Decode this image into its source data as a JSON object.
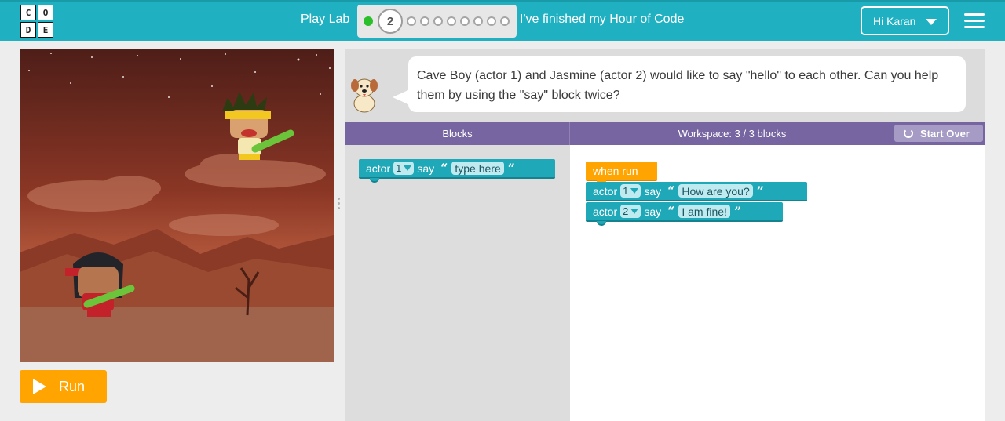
{
  "header": {
    "logo_letters": [
      "C",
      "O",
      "D",
      "E"
    ],
    "title": "Play Lab",
    "current_level": "2",
    "total_dots": 8,
    "finished_link": "I've finished my Hour of Code",
    "user_button": "Hi Karan",
    "menu_icon": "hamburger-icon",
    "accent_color": "#1fb0c2"
  },
  "game": {
    "run_label": "Run",
    "run_color": "#ffa400"
  },
  "instructions": {
    "text": "Cave Boy (actor 1) and Jasmine (actor 2) would like to say \"hello\" to each other. Can you help them by using the \"say\" block twice?"
  },
  "workspace_header": {
    "blocks_label": "Blocks",
    "workspace_label": "Workspace: 3 / 3 blocks",
    "start_over": "Start Over",
    "color": "#7665a0"
  },
  "toolbox": {
    "say_block": {
      "actor": "actor",
      "number": "1",
      "say": "say",
      "open_quote": "“",
      "text": "type here",
      "close_quote": "”"
    }
  },
  "program": {
    "event": "when run",
    "statements": [
      {
        "actor": "actor",
        "number": "1",
        "say": "say",
        "open_quote": "“",
        "text": "How are you?",
        "close_quote": "”"
      },
      {
        "actor": "actor",
        "number": "2",
        "say": "say",
        "open_quote": "“",
        "text": "I am fine!",
        "close_quote": "”"
      }
    ]
  }
}
